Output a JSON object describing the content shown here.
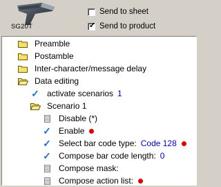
{
  "header": {
    "model": "SG20T",
    "send_to_sheet": {
      "label": "Send to sheet",
      "checked": false
    },
    "send_to_product": {
      "label": "Send to product",
      "checked": true
    }
  },
  "tree": {
    "preamble": "Preamble",
    "postamble": "Postamble",
    "inter_char_delay": "Inter-character/message delay",
    "data_editing": "Data editing",
    "activate_scenarios": {
      "label": "activate scenarios",
      "value": "1"
    },
    "scenario1": "Scenario 1",
    "disable": "Disable (*)",
    "enable": "Enable",
    "select_barcode_type": {
      "label": "Select bar code type:",
      "value": "Code 128"
    },
    "compose_barcode_length": {
      "label": "Compose bar code length:",
      "value": "0"
    },
    "compose_mask": "Compose mask:",
    "compose_action_list": "Compose action list:"
  },
  "colors": {
    "accent_value": "#0000cc",
    "check": "#1a6fd6",
    "indicator": "#e00000",
    "folder": "#f5e06a"
  }
}
